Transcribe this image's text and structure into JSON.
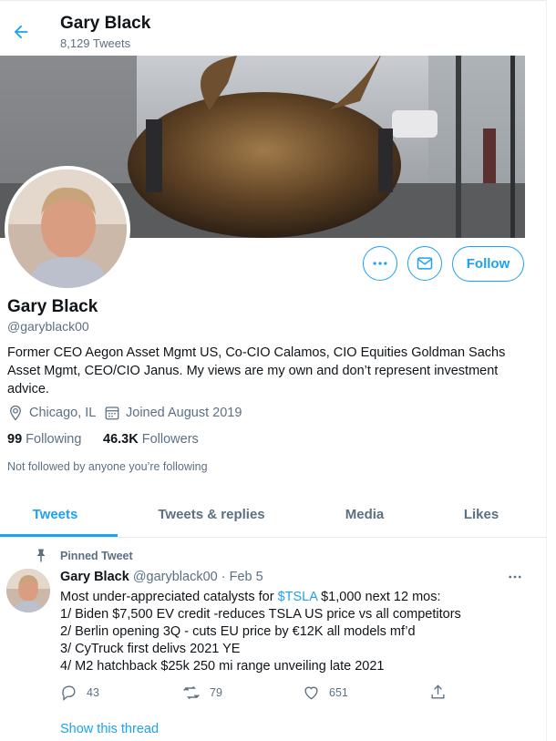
{
  "header": {
    "name": "Gary Black",
    "tweet_count": "8,129 Tweets"
  },
  "profile": {
    "name": "Gary Black",
    "handle": "@garyblack00",
    "bio": "Former CEO Aegon Asset Mgmt US, Co-CIO Calamos, CIO Equities Goldman Sachs Asset Mgmt, CEO/CIO Janus. My views are my own and don’t represent investment advice.",
    "location": "Chicago, IL",
    "joined": "Joined August 2019",
    "following_count": "99",
    "following_label": "Following",
    "followers_count": "46.3K",
    "followers_label": "Followers",
    "not_followed": "Not followed by anyone you’re following",
    "follow_button": "Follow"
  },
  "tabs": [
    {
      "label": "Tweets",
      "active": true
    },
    {
      "label": "Tweets & replies"
    },
    {
      "label": "Media"
    },
    {
      "label": "Likes"
    }
  ],
  "tweet": {
    "pinned_label": "Pinned Tweet",
    "author_name": "Gary Black",
    "author_handle": "@garyblack00",
    "separator": "·",
    "date": "Feb 5",
    "line1_pre": "Most under-appreciated catalysts  for ",
    "line1_cashtag": "$TSLA",
    "line1_post": " $1,000 next 12 mos:",
    "lines": [
      "1/ Biden $7,500 EV credit -reduces TSLA US price vs all competitors",
      "2/ Berlin opening 3Q - cuts EU price by €12K all models mf’d",
      "3/ CyTruck first delivs 2021 YE",
      "4/ M2 hatchback $25k 250 mi range unveiling late 2021"
    ],
    "replies": "43",
    "retweets": "79",
    "likes": "651",
    "show_thread": "Show this thread"
  },
  "colors": {
    "accent": "#1da1f2",
    "secondary_text": "#5b7083",
    "primary_text": "#0f1419"
  },
  "icons": [
    "back-arrow-icon",
    "more-icon",
    "mail-icon",
    "location-icon",
    "calendar-icon",
    "pin-icon",
    "reply-icon",
    "retweet-icon",
    "like-icon",
    "share-icon"
  ]
}
